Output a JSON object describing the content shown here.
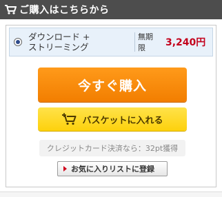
{
  "header": {
    "title": "ご購入はこちらから",
    "icon": "cart-icon"
  },
  "purchase_option": {
    "label_line1": "ダウンロード +",
    "label_line2": "ストリーミング",
    "term": "無期限",
    "price": "3,240円",
    "selected": true
  },
  "buttons": {
    "buy_now": "今すぐ購入",
    "add_to_basket": "バスケットに入れる",
    "add_to_wishlist": "お気に入りリストに登録"
  },
  "credit_note": "クレジットカード決済なら：32pt獲得",
  "colors": {
    "header_bg": "#4d4d4d",
    "buy_button": "#f58a0b",
    "basket_button": "#fdd10c",
    "price_text": "#c3001b",
    "option_bg": "#e8f1fa"
  }
}
